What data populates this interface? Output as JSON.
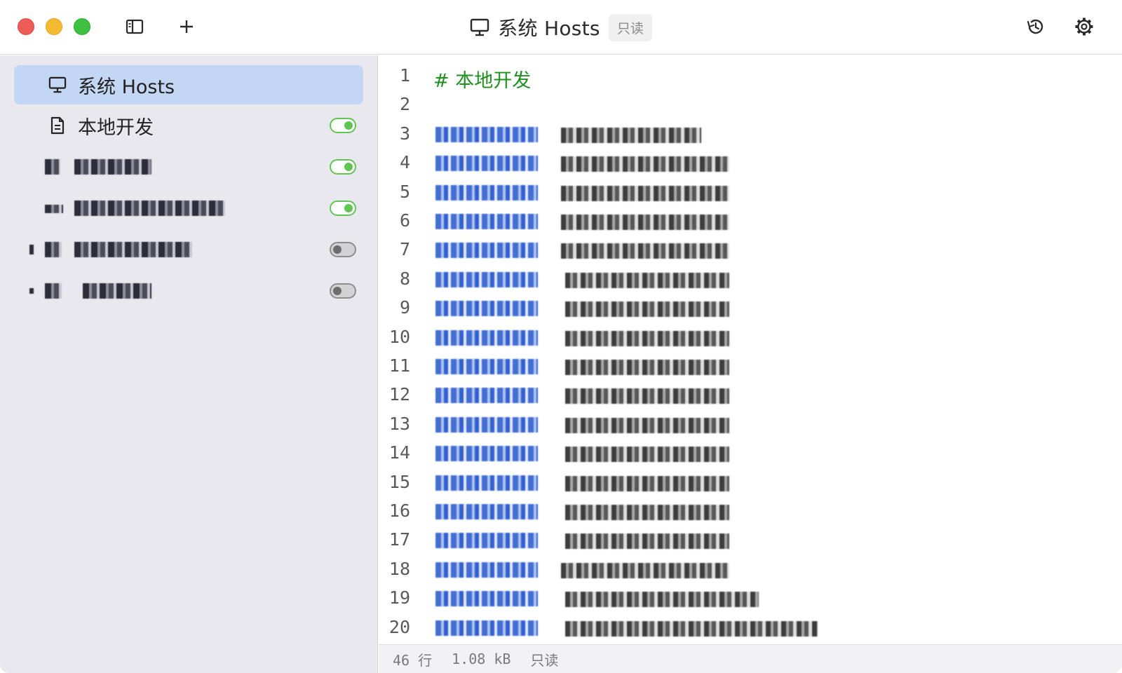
{
  "window": {
    "title": "系统 Hosts",
    "badge": "只读",
    "title_icon": "monitor-icon"
  },
  "toolbar": {
    "sidebar_toggle_icon": "sidebar-icon",
    "add_icon": "plus-icon",
    "history_icon": "history-icon",
    "settings_icon": "gear-icon"
  },
  "sidebar": {
    "items": [
      {
        "label": "系统 Hosts",
        "icon": "monitor-icon",
        "selected": true,
        "toggle": null
      },
      {
        "label": "本地开发",
        "icon": "document-icon",
        "selected": false,
        "toggle": "on"
      },
      {
        "label": "",
        "icon": "redacted",
        "selected": false,
        "toggle": "on"
      },
      {
        "label": "",
        "icon": "redacted",
        "selected": false,
        "toggle": "on"
      },
      {
        "label": "",
        "icon": "redacted",
        "selected": false,
        "toggle": "off"
      },
      {
        "label": "",
        "icon": "redacted",
        "selected": false,
        "toggle": "off"
      }
    ]
  },
  "editor": {
    "lines": [
      {
        "n": "1",
        "text": "# 本地开发"
      },
      {
        "n": "2",
        "text": ""
      },
      {
        "n": "3"
      },
      {
        "n": "4"
      },
      {
        "n": "5"
      },
      {
        "n": "6"
      },
      {
        "n": "7"
      },
      {
        "n": "8"
      },
      {
        "n": "9"
      },
      {
        "n": "10"
      },
      {
        "n": "11"
      },
      {
        "n": "12"
      },
      {
        "n": "13"
      },
      {
        "n": "14"
      },
      {
        "n": "15"
      },
      {
        "n": "16"
      },
      {
        "n": "17"
      },
      {
        "n": "18"
      },
      {
        "n": "19"
      },
      {
        "n": "20"
      }
    ]
  },
  "status": {
    "lines": "46 行",
    "size": "1.08 kB",
    "mode": "只读"
  },
  "colors": {
    "accent_selected": "#c3d6f3",
    "toggle_on": "#61c554",
    "comment": "#1f8f1f",
    "ip": "#2f5fce"
  }
}
